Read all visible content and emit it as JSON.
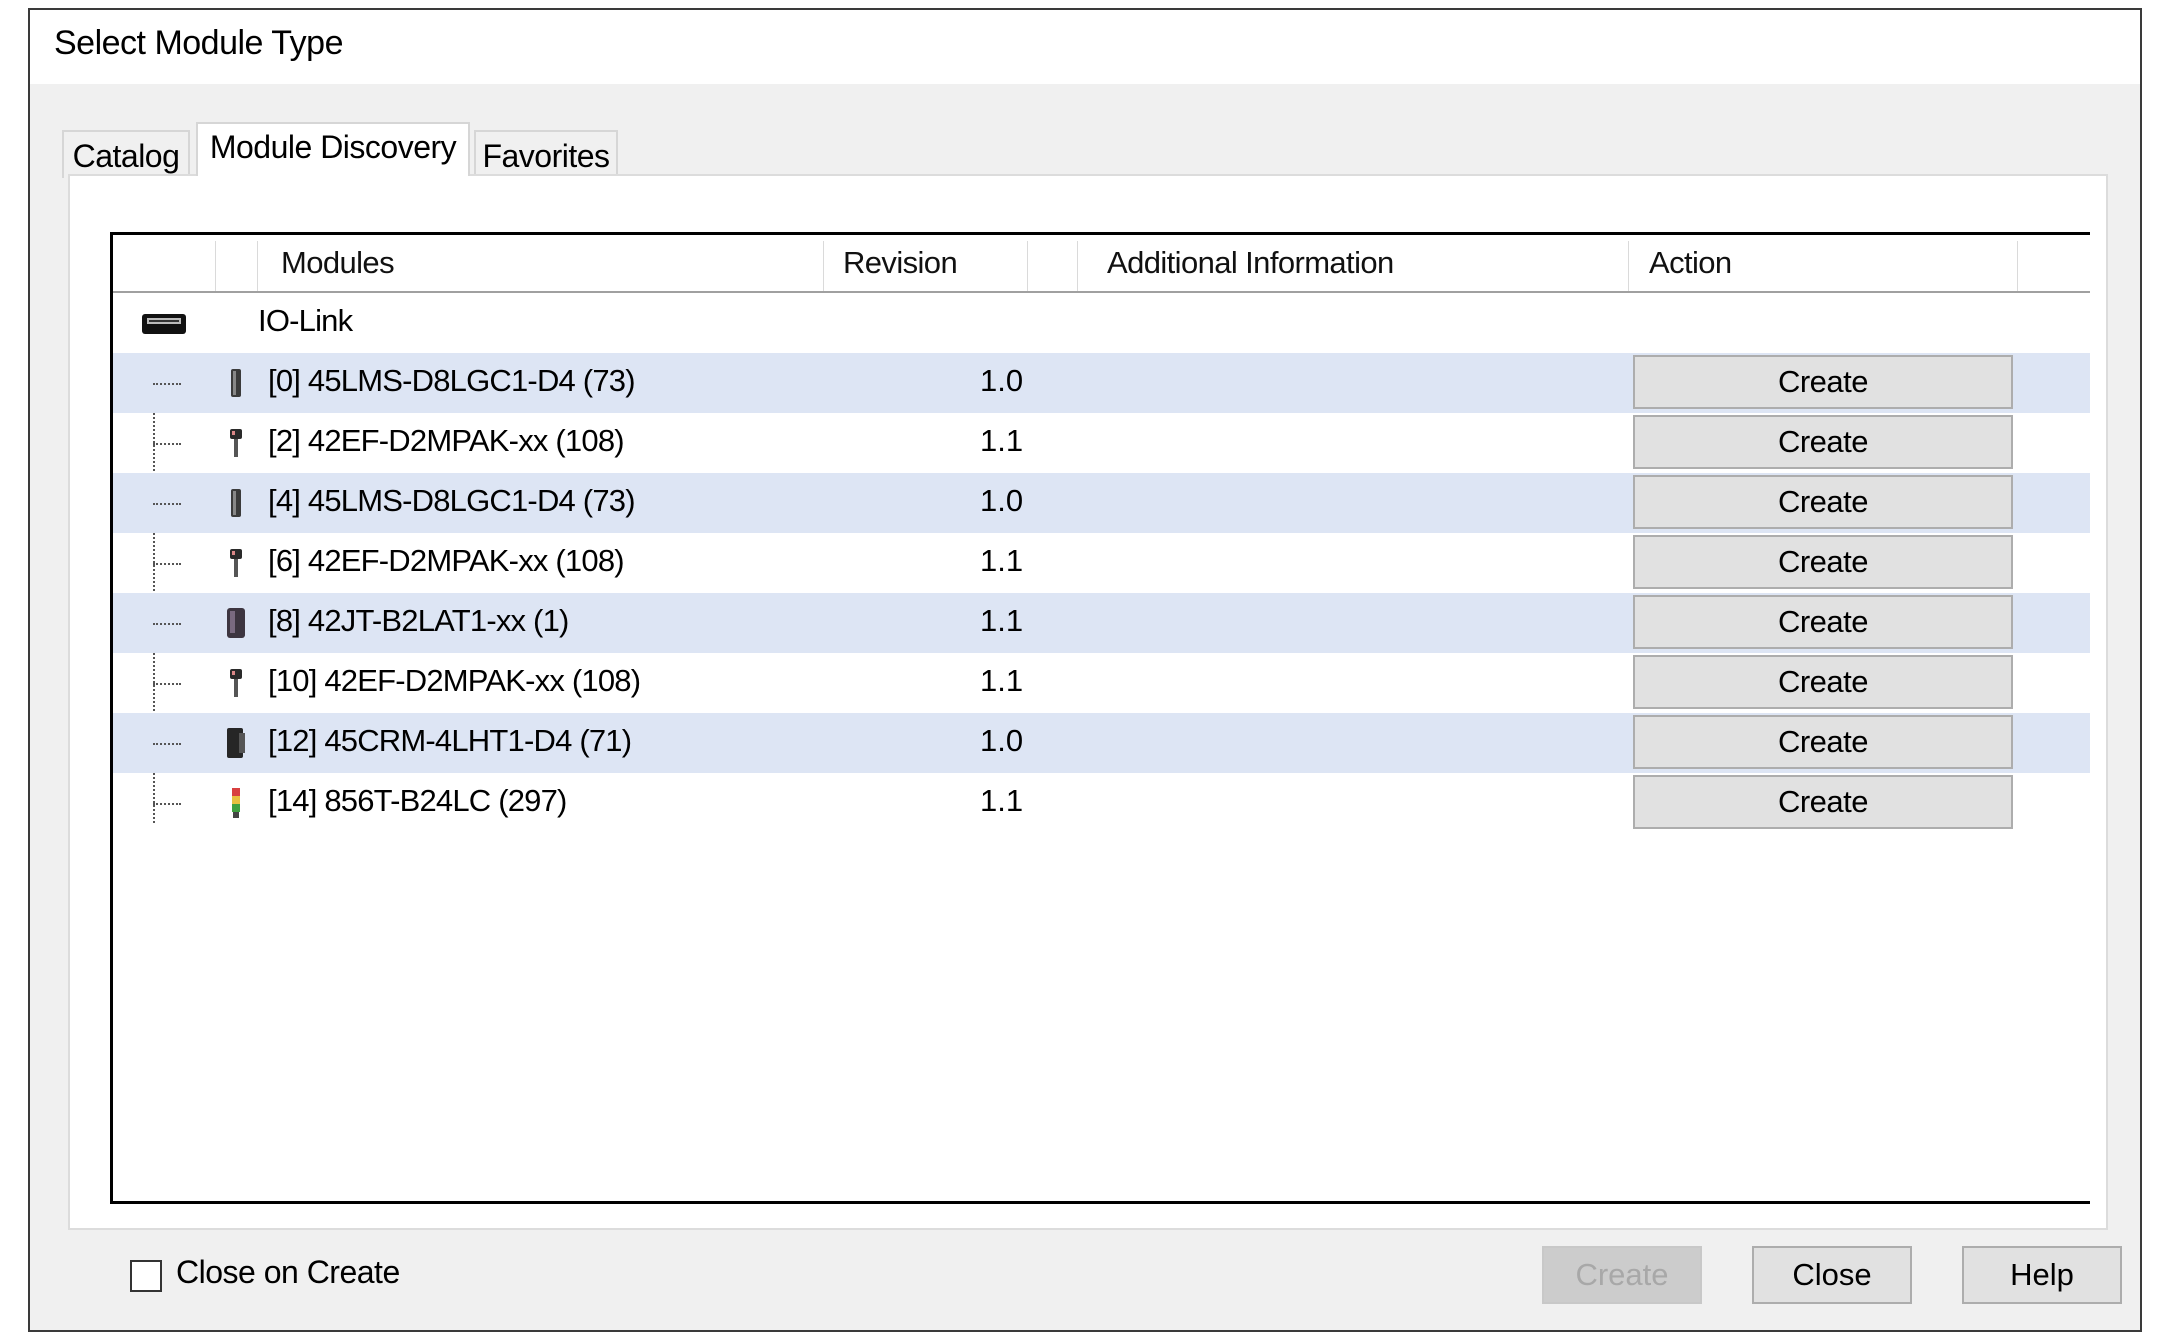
{
  "window": {
    "title": "Select Module Type"
  },
  "tabs": [
    {
      "label": "Catalog",
      "active": false
    },
    {
      "label": "Module Discovery",
      "active": true
    },
    {
      "label": "Favorites",
      "active": false
    }
  ],
  "table": {
    "columns": {
      "modules": "Modules",
      "revision": "Revision",
      "additional_information": "Additional Information",
      "action": "Action"
    },
    "group": {
      "label": "IO-Link",
      "icon": "io-link-adapter-icon"
    },
    "rows": [
      {
        "module": "[0] 45LMS-D8LGC1-D4 (73)",
        "revision": "1.0",
        "additional_information": "",
        "action": "Create",
        "icon": "distance-sensor-icon"
      },
      {
        "module": "[2] 42EF-D2MPAK-xx (108)",
        "revision": "1.1",
        "additional_information": "",
        "action": "Create",
        "icon": "photoelectric-sensor-icon"
      },
      {
        "module": "[4] 45LMS-D8LGC1-D4 (73)",
        "revision": "1.0",
        "additional_information": "",
        "action": "Create",
        "icon": "distance-sensor-icon"
      },
      {
        "module": "[6] 42EF-D2MPAK-xx (108)",
        "revision": "1.1",
        "additional_information": "",
        "action": "Create",
        "icon": "photoelectric-sensor-icon"
      },
      {
        "module": "[8] 42JT-B2LAT1-xx (1)",
        "revision": "1.1",
        "additional_information": "",
        "action": "Create",
        "icon": "block-sensor-icon"
      },
      {
        "module": "[10] 42EF-D2MPAK-xx (108)",
        "revision": "1.1",
        "additional_information": "",
        "action": "Create",
        "icon": "photoelectric-sensor-icon"
      },
      {
        "module": "[12] 45CRM-4LHT1-D4 (71)",
        "revision": "1.0",
        "additional_information": "",
        "action": "Create",
        "icon": "color-sensor-icon"
      },
      {
        "module": "[14] 856T-B24LC (297)",
        "revision": "1.1",
        "additional_information": "",
        "action": "Create",
        "icon": "stack-light-icon"
      }
    ]
  },
  "footer": {
    "close_on_create_label": "Close on Create",
    "close_on_create_checked": false,
    "create_label": "Create",
    "close_label": "Close",
    "help_label": "Help"
  },
  "colors": {
    "row_alt": "#dde5f4",
    "button_face": "#e1e1e1",
    "disabled_text": "#a8a8a8"
  }
}
